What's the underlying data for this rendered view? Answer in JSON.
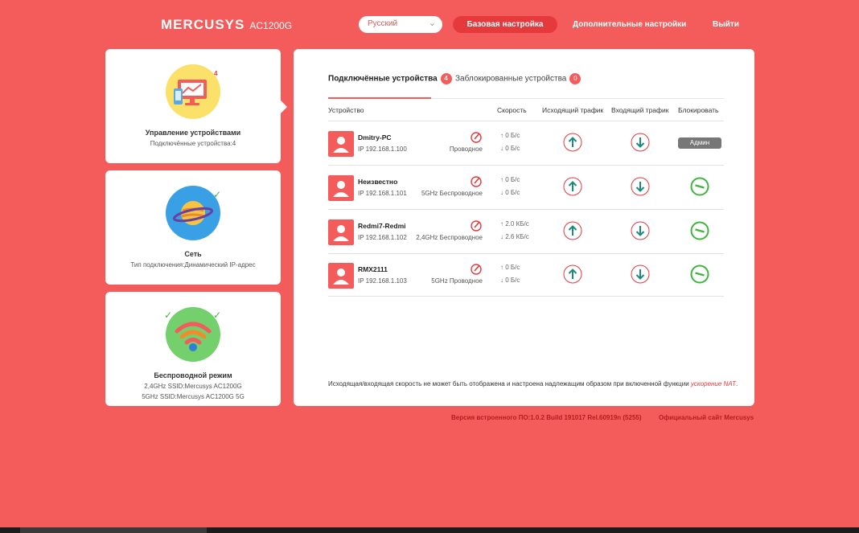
{
  "header": {
    "logo": "MERCUSYS",
    "model": "AC1200G",
    "language": "Русский",
    "nav_basic": "Базовая настройка",
    "nav_advanced": "Дополнительные настройки",
    "nav_logout": "Выйти"
  },
  "cards": {
    "devices": {
      "title": "Управление устройствами",
      "subtitle": "Подключённые устройства:4",
      "badge": "4"
    },
    "network": {
      "title": "Сеть",
      "subtitle": "Тип подключения:Динамический IP-адрес"
    },
    "wireless": {
      "title": "Беспроводной режим",
      "ssid_24": "2,4GHz SSID:Mercusys AC1200G",
      "ssid_5": "5GHz SSID:Mercusys AC1200G 5G"
    }
  },
  "tabs": {
    "connected_label": "Подключённые устройства",
    "connected_count": "4",
    "blocked_label": "Заблокированные устройства",
    "blocked_count": "0"
  },
  "table": {
    "headers": {
      "device": "Устройство",
      "speed": "Скорость",
      "outgoing": "Исходящий трафик",
      "incoming": "Входящий трафик",
      "block": "Блокировать"
    },
    "rows": [
      {
        "name": "Dmitry-PC",
        "ip": "IP 192.168.1.100",
        "conn": "Проводное",
        "up": "0 Б/с",
        "down": "0 Б/с",
        "admin": "Админ"
      },
      {
        "name": "Неизвестно",
        "ip": "IP 192.168.1.101",
        "conn": "5GHz Беспроводное",
        "up": "0 Б/с",
        "down": "0 Б/с"
      },
      {
        "name": "Redmi7-Redmi",
        "ip": "IP 192.168.1.102",
        "conn": "2,4GHz Беспроводное",
        "up": "2.0 КБ/с",
        "down": "2.6 КБ/с"
      },
      {
        "name": "RMX2111",
        "ip": "IP 192.168.1.103",
        "conn": "5GHz Проводное",
        "up": "0 Б/с",
        "down": "0 Б/с"
      }
    ]
  },
  "note": {
    "text": "Исходящая/входящая скорость не может быть отображена и настроена надлежащим образом при включенной функции ",
    "link": "ускорение NAT",
    "end": "."
  },
  "footer": {
    "firmware": "Версия встроенного ПО:1.0.2 Build 191017 Rel.60919n (5255)",
    "site": "Официальный сайт Mercusys"
  },
  "colors": {
    "background": "#f45c5b",
    "accent": "#e6393b",
    "teal": "#1a8a7a",
    "green": "#3fb53f"
  }
}
